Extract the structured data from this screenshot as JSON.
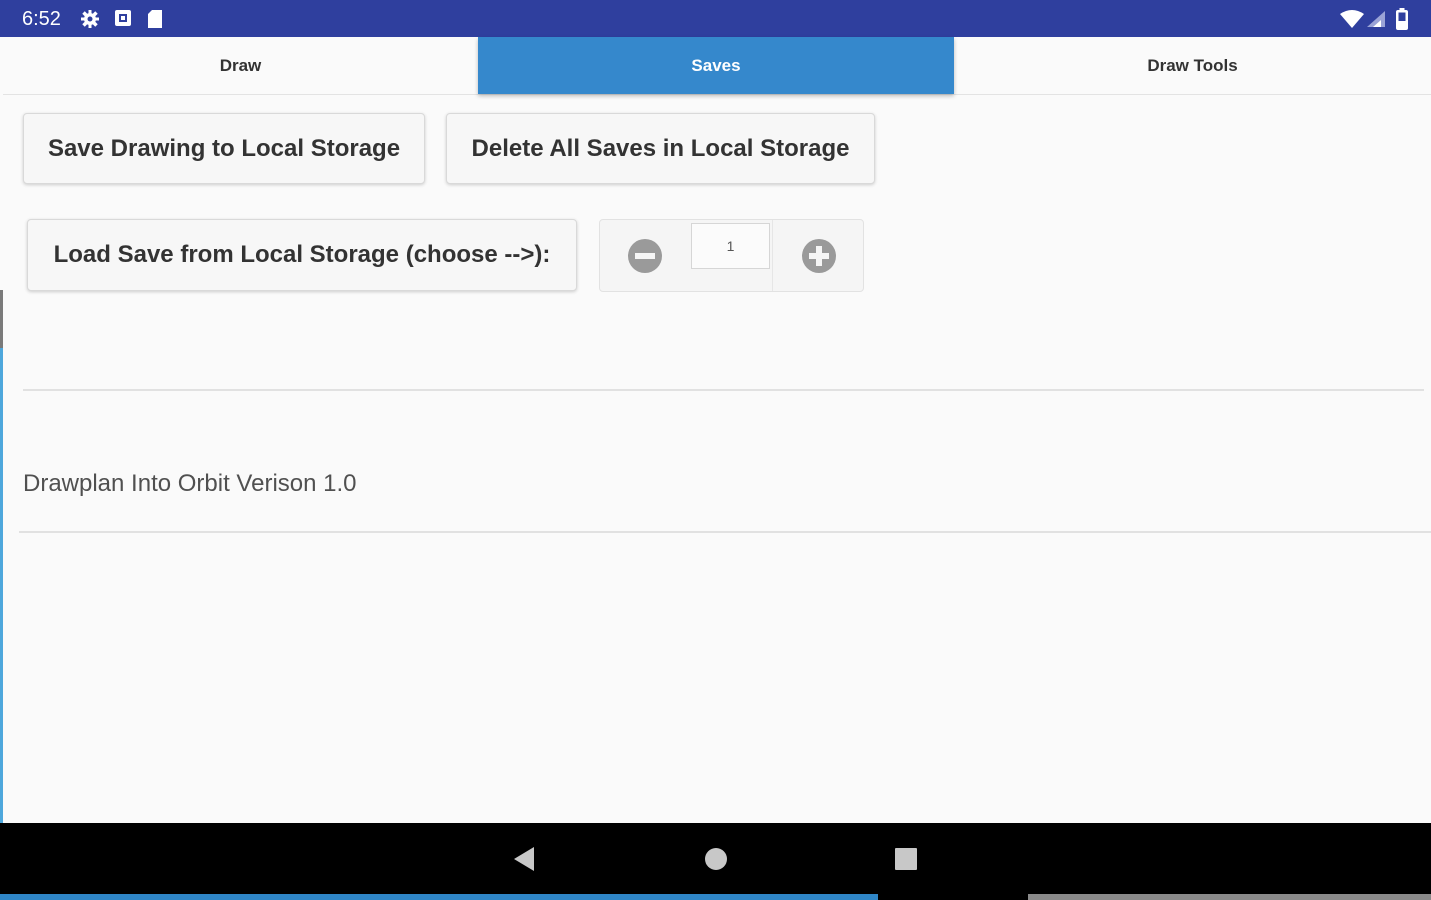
{
  "status_bar": {
    "time": "6:52",
    "color": "#2f3f9e",
    "icons_left": [
      "settings-gear-icon",
      "square-notification-icon",
      "sd-card-icon"
    ],
    "icons_right": [
      "wifi-icon",
      "cell-signal-icon",
      "battery-icon"
    ]
  },
  "tabs": [
    {
      "label": "Draw",
      "active": false
    },
    {
      "label": "Saves",
      "active": true
    },
    {
      "label": "Draw Tools",
      "active": false
    }
  ],
  "accent_color": "#3588cc",
  "buttons": {
    "save": "Save Drawing to Local Storage",
    "delete_all": "Delete All Saves in Local Storage",
    "load": "Load Save from Local Storage (choose -->):"
  },
  "stepper": {
    "value": "1",
    "minus_icon": "minus-circle-icon",
    "plus_icon": "plus-circle-icon"
  },
  "version_text": "Drawplan Into Orbit Verison 1.0",
  "nav_bar": {
    "icons": [
      "back-triangle-icon",
      "home-circle-icon",
      "recents-square-icon"
    ]
  }
}
